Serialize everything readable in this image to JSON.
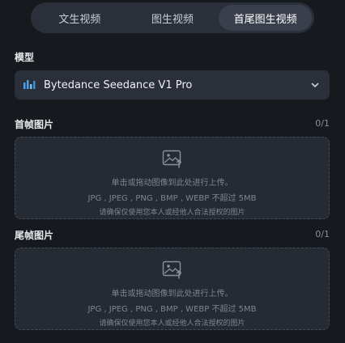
{
  "tabs": [
    {
      "label": "文生视频"
    },
    {
      "label": "图生视频"
    },
    {
      "label": "首尾图生视频",
      "active": true
    }
  ],
  "model": {
    "label": "模型",
    "selected": "Bytedance Seedance V1 Pro",
    "icon": "bars-logo-icon",
    "accent": "#4aa3e8"
  },
  "first_frame": {
    "label": "首帧图片",
    "count": "0/1",
    "icon": "image-upload-icon",
    "hint": "单击或拖动图像到此处进行上传。",
    "formats": "JPG , JPEG , PNG , BMP , WEBP 不超过 5MB",
    "notice": "请确保仅使用您本人或经他人合法授权的图片"
  },
  "last_frame": {
    "label": "尾帧图片",
    "count": "0/1",
    "icon": "image-upload-icon",
    "hint": "单击或拖动图像到此处进行上传。",
    "formats": "JPG , JPEG , PNG , BMP , WEBP 不超过 5MB",
    "notice": "请确保仅使用您本人或经他人合法授权的图片"
  }
}
